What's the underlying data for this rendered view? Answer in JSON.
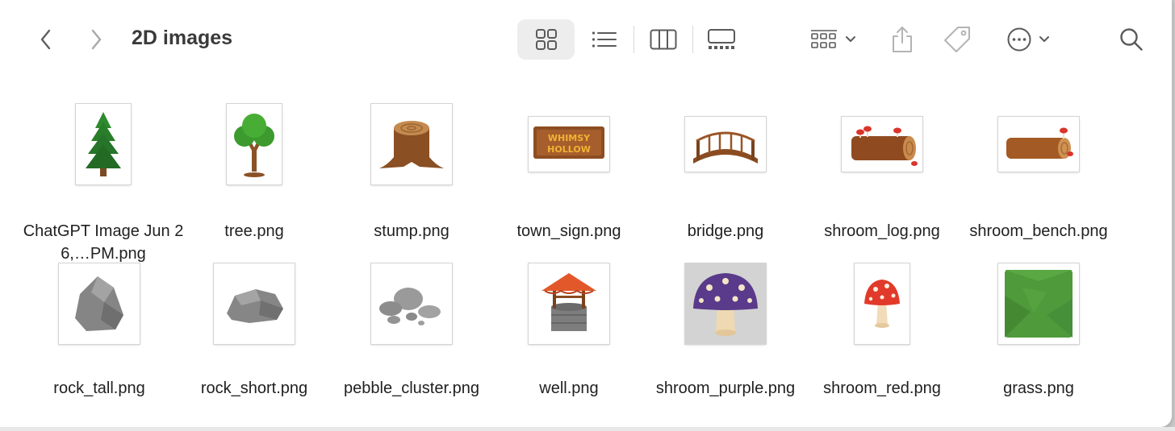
{
  "window": {
    "title": "2D images"
  },
  "toolbar": {
    "back_icon": "chevron-left-icon",
    "forward_icon": "chevron-right-icon",
    "views": [
      "icon-view-icon",
      "list-view-icon",
      "column-view-icon",
      "gallery-view-icon"
    ],
    "active_view": "icon-view-icon",
    "actions": [
      "group-icon",
      "share-icon",
      "tag-icon",
      "more-icon",
      "search-icon"
    ]
  },
  "files": [
    {
      "name": "ChatGPT Image Jun 26,…PM.png",
      "thumb": "pine-tree"
    },
    {
      "name": "tree.png",
      "thumb": "tree"
    },
    {
      "name": "stump.png",
      "thumb": "stump"
    },
    {
      "name": "town_sign.png",
      "thumb": "town-sign",
      "sign_text": [
        "WHIMSY",
        "HOLLOW"
      ]
    },
    {
      "name": "bridge.png",
      "thumb": "bridge"
    },
    {
      "name": "shroom_log.png",
      "thumb": "shroom-log"
    },
    {
      "name": "shroom_bench.png",
      "thumb": "shroom-bench"
    },
    {
      "name": "rock_tall.png",
      "thumb": "rock-tall"
    },
    {
      "name": "rock_short.png",
      "thumb": "rock-short"
    },
    {
      "name": "pebble_cluster.png",
      "thumb": "pebble-cluster"
    },
    {
      "name": "well.png",
      "thumb": "well"
    },
    {
      "name": "shroom_purple.png",
      "thumb": "shroom-purple"
    },
    {
      "name": "shroom_red.png",
      "thumb": "shroom-red"
    },
    {
      "name": "grass.png",
      "thumb": "grass"
    }
  ],
  "colors": {
    "window_bg": "#ffffff",
    "title_text": "#3a3a3a",
    "icon_gray": "#6e6e6e",
    "active_view_bg": "#ededed"
  }
}
